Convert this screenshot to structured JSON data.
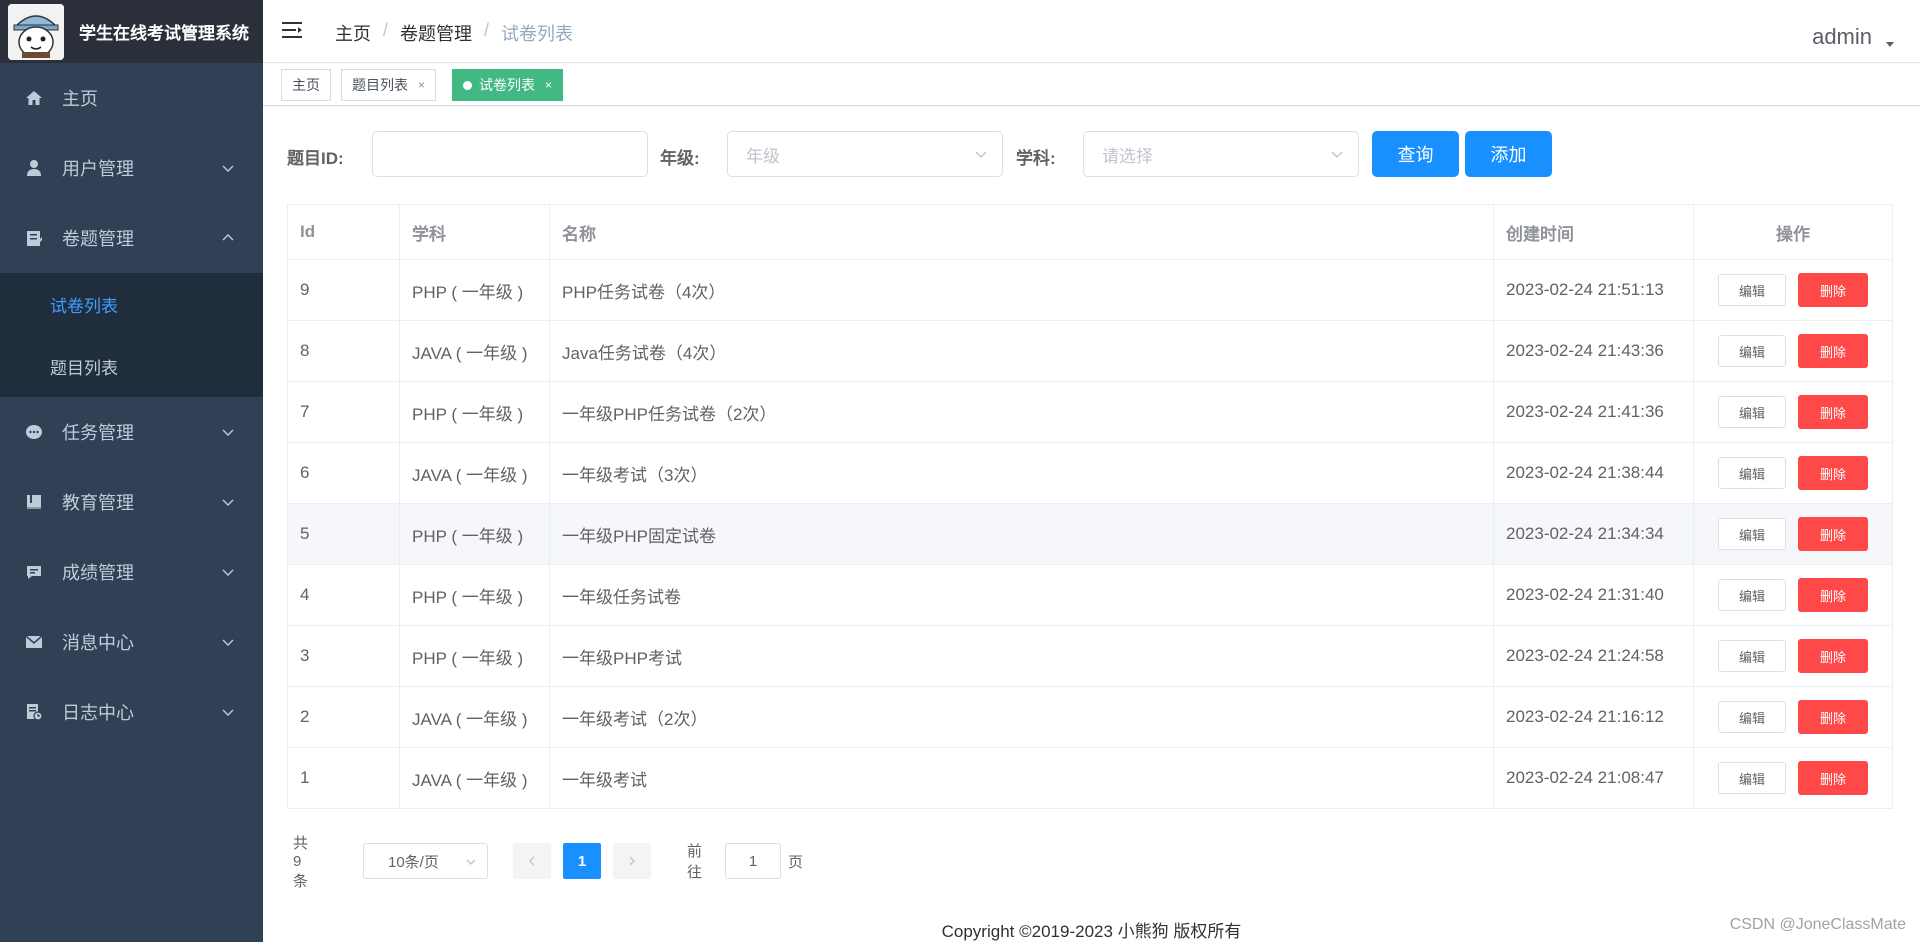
{
  "app": {
    "title": "学生在线考试管理系统"
  },
  "sidebar": {
    "items": [
      {
        "label": "主页",
        "icon": "home-icon"
      },
      {
        "label": "用户管理",
        "icon": "user-icon"
      },
      {
        "label": "卷题管理",
        "icon": "paper-icon",
        "expanded": true,
        "children": [
          {
            "label": "试卷列表",
            "active": true
          },
          {
            "label": "题目列表"
          }
        ]
      },
      {
        "label": "任务管理",
        "icon": "task-icon"
      },
      {
        "label": "教育管理",
        "icon": "book-icon"
      },
      {
        "label": "成绩管理",
        "icon": "chat-icon"
      },
      {
        "label": "消息中心",
        "icon": "mail-icon"
      },
      {
        "label": "日志中心",
        "icon": "log-icon"
      }
    ]
  },
  "header": {
    "breadcrumb": [
      "主页",
      "卷题管理",
      "试卷列表"
    ],
    "user": "admin"
  },
  "tags": [
    {
      "label": "主页",
      "closable": false
    },
    {
      "label": "题目列表",
      "closable": true
    },
    {
      "label": "试卷列表",
      "closable": true,
      "active": true
    }
  ],
  "filter": {
    "id_label": "题目ID:",
    "id_value": "",
    "grade_label": "年级:",
    "grade_placeholder": "年级",
    "subject_label": "学科:",
    "subject_placeholder": "请选择",
    "query_button": "查询",
    "add_button": "添加"
  },
  "table": {
    "columns": [
      "Id",
      "学科",
      "名称",
      "创建时间",
      "操作"
    ],
    "rows": [
      {
        "id": "9",
        "subject": "PHP ( 一年级 )",
        "name": "PHP任务试卷（4次）",
        "time": "2023-02-24 21:51:13"
      },
      {
        "id": "8",
        "subject": "JAVA ( 一年级 )",
        "name": "Java任务试卷（4次）",
        "time": "2023-02-24 21:43:36"
      },
      {
        "id": "7",
        "subject": "PHP ( 一年级 )",
        "name": "一年级PHP任务试卷（2次）",
        "time": "2023-02-24 21:41:36"
      },
      {
        "id": "6",
        "subject": "JAVA ( 一年级 )",
        "name": "一年级考试（3次）",
        "time": "2023-02-24 21:38:44"
      },
      {
        "id": "5",
        "subject": "PHP ( 一年级 )",
        "name": "一年级PHP固定试卷",
        "time": "2023-02-24 21:34:34",
        "hover": true
      },
      {
        "id": "4",
        "subject": "PHP ( 一年级 )",
        "name": "一年级任务试卷",
        "time": "2023-02-24 21:31:40"
      },
      {
        "id": "3",
        "subject": "PHP ( 一年级 )",
        "name": "一年级PHP考试",
        "time": "2023-02-24 21:24:58"
      },
      {
        "id": "2",
        "subject": "JAVA ( 一年级 )",
        "name": "一年级考试（2次）",
        "time": "2023-02-24 21:16:12"
      },
      {
        "id": "1",
        "subject": "JAVA ( 一年级 )",
        "name": "一年级考试",
        "time": "2023-02-24 21:08:47"
      }
    ],
    "edit_label": "编辑",
    "delete_label": "删除"
  },
  "pagination": {
    "total_text": "共 9 条",
    "page_size": "10条/页",
    "current_page": "1",
    "goto_prefix": "前往",
    "goto_value": "1",
    "goto_suffix": "页"
  },
  "footer": {
    "copyright": "Copyright ©2019-2023 小熊狗 版权所有",
    "watermark": "CSDN @JoneClassMate"
  },
  "colors": {
    "sidebar_bg": "#304156",
    "primary": "#1890ff",
    "danger": "#ff4949",
    "tag_active": "#42b983"
  }
}
